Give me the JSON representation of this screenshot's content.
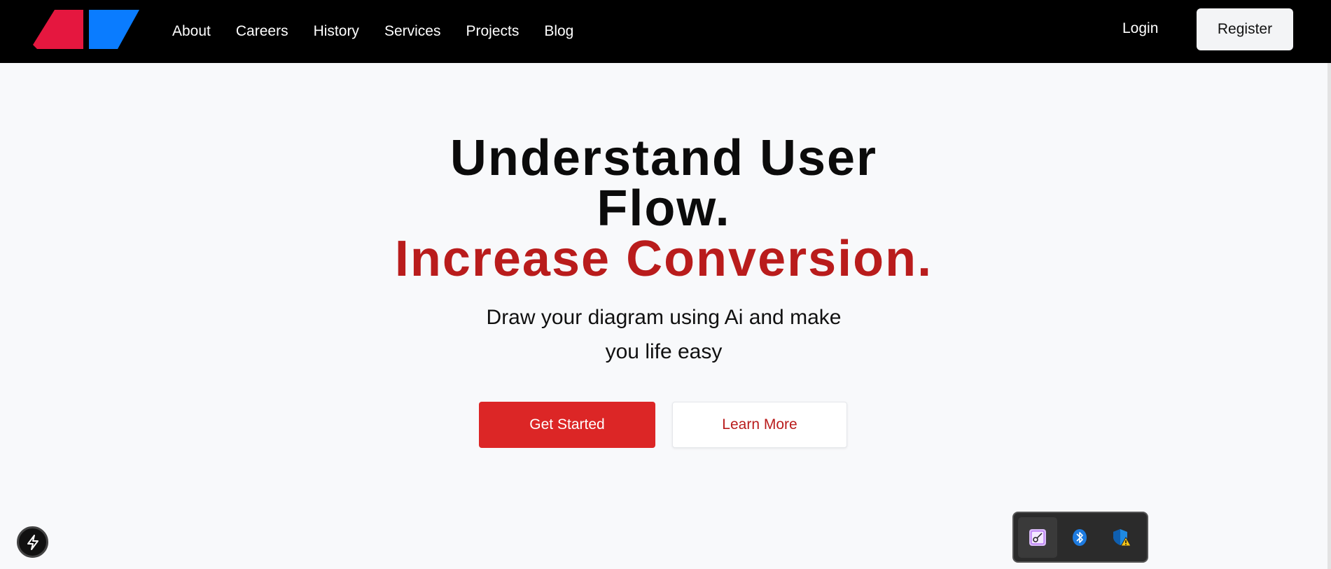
{
  "nav": {
    "links": [
      "About",
      "Careers",
      "History",
      "Services",
      "Projects",
      "Blog"
    ],
    "login_label": "Login",
    "register_label": "Register"
  },
  "hero": {
    "headline_line1": "Understand User",
    "headline_line2": "Flow.",
    "headline_line3": "Increase Conversion.",
    "subtitle": "Draw your diagram using Ai and make you life easy",
    "primary_cta": "Get Started",
    "secondary_cta": "Learn More"
  },
  "colors": {
    "accent": "#dc2626",
    "accent_text": "#b91c1c",
    "logo_red": "#e5173f",
    "logo_blue": "#0a7cff"
  },
  "icons": {
    "bolt": "lightning-icon",
    "tray": [
      "snipping-tool-icon",
      "bluetooth-icon",
      "defender-warning-icon"
    ]
  }
}
